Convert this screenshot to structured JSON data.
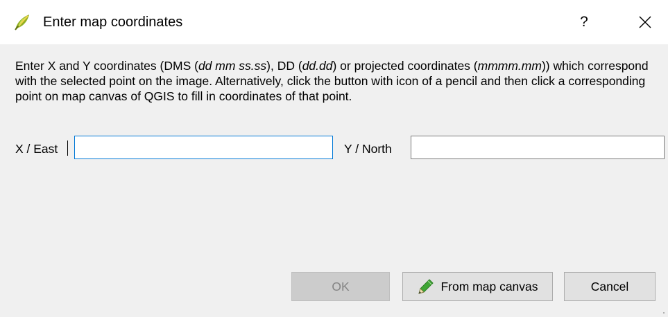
{
  "window": {
    "title": "Enter map coordinates",
    "help_glyph": "?",
    "close_glyph": "✕",
    "app_icon": "qgis-leaf-icon"
  },
  "description": {
    "part1": "Enter X and Y coordinates (DMS (",
    "dms_format": "dd mm ss.ss",
    "part2": "), DD (",
    "dd_format": "dd.dd",
    "part3": ") or projected coordinates (",
    "proj_format": "mmmm.mm",
    "part4": ")) which correspond with the selected point on the image. Alternatively, click the button with icon of a pencil and then click a corresponding point on map canvas of QGIS to fill in coordinates of that point."
  },
  "x_field": {
    "label": "X / East",
    "value": "",
    "focused": true
  },
  "y_field": {
    "label": "Y / North",
    "value": ""
  },
  "buttons": {
    "ok_label": "OK",
    "ok_enabled": false,
    "from_canvas_label": "From map canvas",
    "from_canvas_icon": "pencil-icon",
    "cancel_label": "Cancel"
  },
  "colors": {
    "focus_border": "#0078d7",
    "dialog_bg": "#f0f0f0",
    "button_bg": "#e1e1e1",
    "disabled_text": "#838383"
  }
}
